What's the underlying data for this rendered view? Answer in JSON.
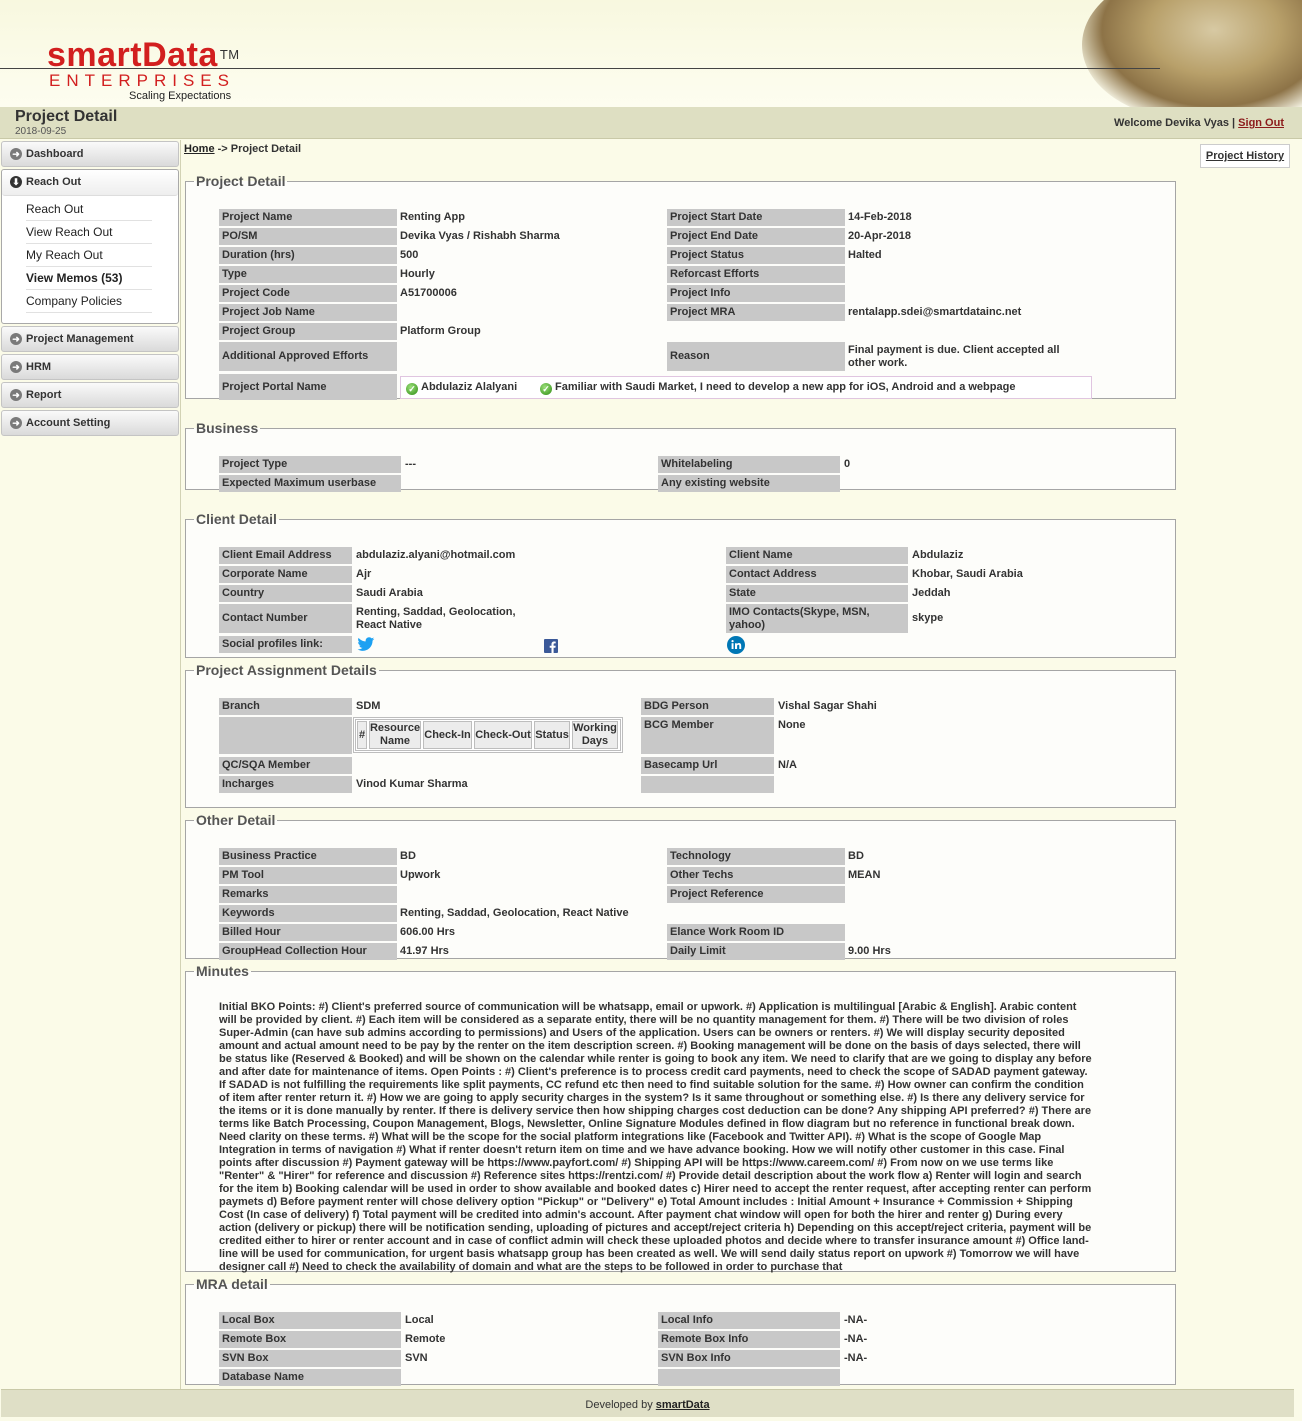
{
  "header": {
    "brand": "smartData",
    "tm": "TM",
    "enterprises": "ENTERPRISES",
    "tagline": "Scaling Expectations"
  },
  "titlebar": {
    "title": "Project Detail",
    "date": "2018-09-25",
    "welcome": "Welcome Devika Vyas |",
    "sign_out": "Sign Out"
  },
  "sidebar": {
    "dashboard": "Dashboard",
    "reach_out": "Reach Out",
    "sub": [
      "Reach Out",
      "View Reach Out",
      "My Reach Out",
      "View Memos (53)",
      "Company Policies"
    ],
    "project_management": "Project Management",
    "hrm": "HRM",
    "report": "Report",
    "account_setting": "Account Setting"
  },
  "breadcrumb": {
    "home": "Home",
    "sep": " -> ",
    "current": "Project Detail"
  },
  "project_history": "Project History",
  "project_detail": {
    "legend": "Project Detail",
    "left": [
      {
        "label": "Project Name",
        "value": "Renting App"
      },
      {
        "label": "PO/SM",
        "value": "Devika Vyas / Rishabh Sharma"
      },
      {
        "label": "Duration (hrs)",
        "value": "500"
      },
      {
        "label": "Type",
        "value": "Hourly"
      },
      {
        "label": "Project Code",
        "value": "A51700006"
      },
      {
        "label": "Project Job Name",
        "value": ""
      },
      {
        "label": "Project Group",
        "value": "Platform Group"
      },
      {
        "label": "Additional Approved Efforts",
        "value": ""
      }
    ],
    "right": [
      {
        "label": "Project Start Date",
        "value": "14-Feb-2018"
      },
      {
        "label": "Project End Date",
        "value": "20-Apr-2018"
      },
      {
        "label": "Project Status",
        "value": "Halted"
      },
      {
        "label": "Reforcast Efforts",
        "value": ""
      },
      {
        "label": "Project Info",
        "value": ""
      },
      {
        "label": "Project MRA",
        "value": "rentalapp.sdei@smartdatainc.net"
      },
      {
        "label": "",
        "value": ""
      },
      {
        "label": "Reason",
        "value": "Final payment is due. Client accepted all other work."
      }
    ],
    "portal_label": "Project Portal Name",
    "portal_1": "Abdulaziz Alalyani",
    "portal_2": "Familiar with Saudi Market, I need to develop a new app for iOS, Android and a webpage"
  },
  "business": {
    "legend": "Business",
    "rows": [
      {
        "label": "Project Type",
        "value": "---",
        "label2": "Whitelabeling",
        "value2": "0"
      },
      {
        "label": "Expected Maximum userbase",
        "value": "",
        "label2": "Any existing website",
        "value2": ""
      }
    ]
  },
  "client": {
    "legend": "Client Detail",
    "rows": [
      {
        "label": "Client Email Address",
        "value": "abdulaziz.alyani@hotmail.com",
        "label2": "Client Name",
        "value2": "Abdulaziz"
      },
      {
        "label": "Corporate Name",
        "value": "Ajr",
        "label2": "Contact Address",
        "value2": "Khobar, Saudi Arabia"
      },
      {
        "label": "Country",
        "value": "Saudi Arabia",
        "label2": "State",
        "value2": "Jeddah"
      },
      {
        "label": "Contact Number",
        "value": "Renting, Saddad, Geolocation, React Native",
        "label2": "IMO Contacts(Skype, MSN, yahoo)",
        "value2": "skype"
      }
    ],
    "social_label": "Social profiles link:",
    "twitter_color": "#1da1f2",
    "facebook_color": "#3b5998",
    "linkedin_color": "#0077b5"
  },
  "assignment": {
    "legend": "Project Assignment Details",
    "branch_label": "Branch",
    "branch": "SDM",
    "qc_label": "QC/SQA Member",
    "qc": "",
    "incharges_label": "Incharges",
    "incharges": "Vinod Kumar Sharma",
    "bdg_label": "BDG Person",
    "bdg": "Vishal Sagar Shahi",
    "bcg_label": "BCG Member",
    "bcg": "None",
    "basecamp_label": "Basecamp Url",
    "basecamp": "N/A",
    "table_headers": [
      "#",
      "Resource Name",
      "Check-In",
      "Check-Out",
      "Status",
      "Working Days"
    ]
  },
  "other": {
    "legend": "Other Detail",
    "left": [
      {
        "label": "Business Practice",
        "value": "BD"
      },
      {
        "label": "PM Tool",
        "value": "Upwork"
      },
      {
        "label": "Remarks",
        "value": ""
      },
      {
        "label": "Keywords",
        "value": "Renting, Saddad, Geolocation, React Native"
      },
      {
        "label": "Billed Hour",
        "value": "606.00 Hrs"
      },
      {
        "label": "GroupHead Collection Hour",
        "value": "41.97 Hrs"
      }
    ],
    "right": [
      {
        "label": "Technology",
        "value": "BD"
      },
      {
        "label": "Other Techs",
        "value": "MEAN"
      },
      {
        "label": "Project Reference",
        "value": ""
      },
      {
        "label": "",
        "value": ""
      },
      {
        "label": "Elance Work Room ID",
        "value": ""
      },
      {
        "label": "Daily Limit",
        "value": "9.00 Hrs"
      }
    ]
  },
  "minutes": {
    "legend": "Minutes",
    "text": "Initial BKO Points: #) Client's preferred source of communication will be whatsapp, email or upwork. #) Application is multilingual [Arabic & English]. Arabic content will be provided by client. #) Each item will be considered as a separate entity, there will be no quantity management for them. #) There will be two division of roles Super-Admin (can have sub admins according to permissions) and Users of the application. Users can be owners or renters. #) We will display security deposited amount and actual amount need to be pay by the renter on the item description screen. #) Booking management will be done on the basis of days selected, there will be status like (Reserved & Booked) and will be shown on the calendar while renter is going to book any item. We need to clarify that are we going to display any before and after date for maintenance of items. Open Points : #) Client's preference is to process credit card payments, need to check the scope of SADAD payment gateway. If SADAD is not fulfilling the requirements like split payments, CC refund etc then need to find suitable solution for the same. #) How owner can confirm the condition of item after renter return it. #) How we are going to apply security charges in the system? Is it same throughout or something else. #) Is there any delivery service for the items or it is done manually by renter. If there is delivery service then how shipping charges cost deduction can be done? Any shipping API preferred? #) There are terms like Batch Processing, Coupon Management, Blogs, Newsletter, Online Signature Modules defined in flow diagram but no reference in functional break down. Need clarity on these terms. #) What will be the scope for the social platform integrations like (Facebook and Twitter API). #) What is the scope of Google Map Integration in terms of navigation #) What if renter doesn't return item on time and we have advance booking. How we will notify other customer in this case. Final points after discussion #) Payment gateway will be https://www.payfort.com/ #) Shipping API will be https://www.careem.com/ #) From now on we use terms like \"Renter\" & \"Hirer\" for reference and discussion #) Reference sites https://rentzi.com/ #) Provide detail description about the work flow a) Renter will login and search for the item b) Booking calendar will be used in order to show available and booked dates c) Hirer need to accept the renter request, after accepting renter can perform paymets d) Before payment renter will chose delivery option \"Pickup\" or \"Delivery\" e) Total Amount includes : Initial Amount + Insurance + Commission + Shipping Cost (In case of delivery) f) Total payment will be credited into admin's account. After payment chat window will open for both the hirer and renter g) During every action (delivery or pickup) there will be notification sending, uploading of pictures and accept/reject criteria h) Depending on this accept/reject criteria, payment will be credited either to hirer or renter account and in case of conflict admin will check these uploaded photos and decide where to transfer insurance amount #) Office land-line will be used for communication, for urgent basis whatsapp group has been created as well. We will send daily status report on upwork #) Tomorrow we will have designer call #) Need to check the availability of domain and what are the steps to be followed in order to purchase that"
  },
  "mra": {
    "legend": "MRA detail",
    "rows": [
      {
        "label": "Local Box",
        "value": "Local",
        "label2": "Local Info",
        "value2": "-NA-"
      },
      {
        "label": "Remote Box",
        "value": "Remote",
        "label2": "Remote Box Info",
        "value2": "-NA-"
      },
      {
        "label": "SVN Box",
        "value": "SVN",
        "label2": "SVN Box Info",
        "value2": "-NA-"
      },
      {
        "label": "Database Name",
        "value": "",
        "label2": "",
        "value2": ""
      }
    ]
  },
  "footer": {
    "text": "Developed by",
    "link": "smartData"
  }
}
